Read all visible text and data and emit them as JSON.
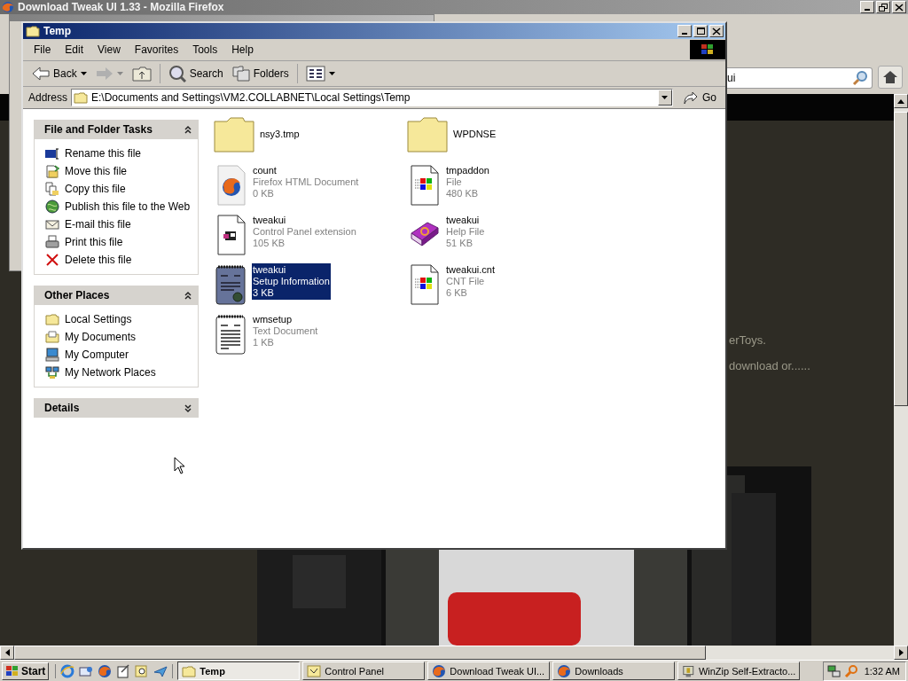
{
  "background_window": {
    "title": "Download Tweak UI 1.33 - Mozilla Firefox",
    "search_value": "ui",
    "page_lines": [
      "erToys.",
      "download or......"
    ]
  },
  "window": {
    "title": "Temp",
    "menu": [
      "File",
      "Edit",
      "View",
      "Favorites",
      "Tools",
      "Help"
    ],
    "toolbar": [
      {
        "kind": "back",
        "label": "Back"
      },
      {
        "kind": "forward"
      },
      {
        "kind": "up"
      },
      {
        "kind": "search",
        "label": "Search"
      },
      {
        "kind": "folders",
        "label": "Folders"
      },
      {
        "kind": "views"
      }
    ],
    "address": {
      "label": "Address",
      "value": "E:\\Documents and Settings\\VM2.COLLABNET\\Local Settings\\Temp",
      "go": "Go"
    },
    "task_panes": [
      {
        "title": "File and Folder Tasks",
        "expanded": true,
        "items": [
          {
            "kind": "rename",
            "label": "Rename this file"
          },
          {
            "kind": "move",
            "label": "Move this file"
          },
          {
            "kind": "copy",
            "label": "Copy this file"
          },
          {
            "kind": "publish",
            "label": "Publish this file to the Web"
          },
          {
            "kind": "email",
            "label": "E-mail this file"
          },
          {
            "kind": "print",
            "label": "Print this file"
          },
          {
            "kind": "delete",
            "label": "Delete this file"
          }
        ]
      },
      {
        "title": "Other Places",
        "expanded": true,
        "items": [
          {
            "kind": "folder",
            "label": "Local Settings"
          },
          {
            "kind": "documents",
            "label": "My Documents"
          },
          {
            "kind": "computer",
            "label": "My Computer"
          },
          {
            "kind": "network",
            "label": "My Network Places"
          }
        ]
      },
      {
        "title": "Details",
        "expanded": false
      }
    ],
    "files": [
      {
        "kind": "folder",
        "name": "nsy3.tmp",
        "selected": false
      },
      {
        "kind": "folder",
        "name": "WPDNSE",
        "selected": false
      },
      {
        "kind": "firefox",
        "name": "count",
        "type": "Firefox HTML Document",
        "size": "0 KB",
        "selected": false
      },
      {
        "kind": "windows",
        "name": "tmpaddon",
        "type": "File",
        "size": "480 KB",
        "selected": false
      },
      {
        "kind": "cpl",
        "name": "tweakui",
        "type": "Control Panel extension",
        "size": "105 KB",
        "selected": false
      },
      {
        "kind": "help",
        "name": "tweakui",
        "type": "Help File",
        "size": "51 KB",
        "selected": false
      },
      {
        "kind": "inf",
        "name": "tweakui",
        "type": "Setup Information",
        "size": "3 KB",
        "selected": true
      },
      {
        "kind": "windows",
        "name": "tweakui.cnt",
        "type": "CNT File",
        "size": "6 KB",
        "selected": false
      },
      {
        "kind": "text",
        "name": "wmsetup",
        "type": "Text Document",
        "size": "1 KB",
        "selected": false
      }
    ]
  },
  "taskbar": {
    "start": "Start",
    "buttons": [
      {
        "kind": "folder",
        "label": "Temp",
        "selected": true
      },
      {
        "kind": "cpanel",
        "label": "Control Panel",
        "selected": false
      },
      {
        "kind": "firefox",
        "label": "Download Tweak UI...",
        "selected": false
      },
      {
        "kind": "firefox",
        "label": "Downloads",
        "selected": false
      },
      {
        "kind": "winzip",
        "label": "WinZip Self-Extracto...",
        "selected": false
      }
    ],
    "clock": "1:32 AM"
  }
}
